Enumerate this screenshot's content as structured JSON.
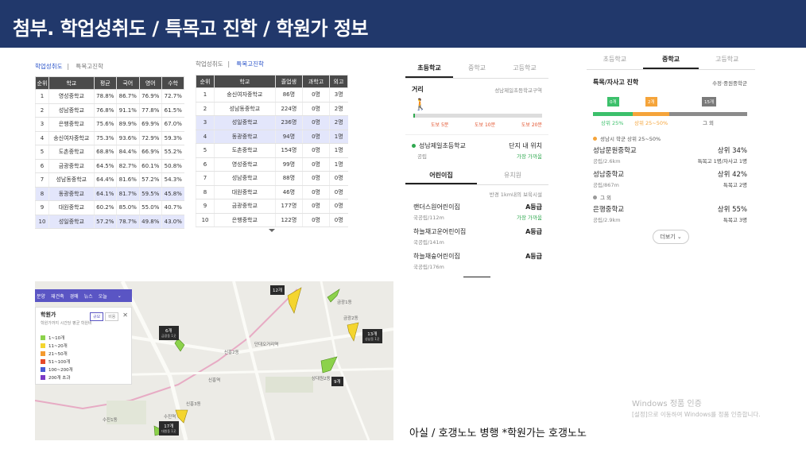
{
  "slide_title": "첨부. 학업성취도 / 특목고 진학 / 학원가 정보",
  "achievement": {
    "tabs": [
      "학업성취도",
      "특목고진학"
    ],
    "headers": [
      "순위",
      "학교",
      "평균",
      "국어",
      "영어",
      "수학"
    ],
    "rows": [
      [
        "1",
        "영성중학교",
        "78.8%",
        "86.7%",
        "76.9%",
        "72.7%"
      ],
      [
        "2",
        "성남중학교",
        "76.8%",
        "91.1%",
        "77.8%",
        "61.5%"
      ],
      [
        "3",
        "은행중학교",
        "75.6%",
        "89.9%",
        "69.9%",
        "67.0%"
      ],
      [
        "4",
        "송신여자중학교",
        "75.3%",
        "93.6%",
        "72.9%",
        "59.3%"
      ],
      [
        "5",
        "도촌중학교",
        "68.8%",
        "84.4%",
        "66.9%",
        "55.2%"
      ],
      [
        "6",
        "금광중학교",
        "64.5%",
        "82.7%",
        "60.1%",
        "50.8%"
      ],
      [
        "7",
        "성남동중학교",
        "64.4%",
        "81.6%",
        "57.2%",
        "54.3%"
      ],
      [
        "8",
        "동광중학교",
        "64.1%",
        "81.7%",
        "59.5%",
        "45.8%"
      ],
      [
        "9",
        "대원중학교",
        "60.2%",
        "85.0%",
        "55.0%",
        "40.7%"
      ],
      [
        "10",
        "성일중학교",
        "57.2%",
        "78.7%",
        "49.8%",
        "43.0%"
      ]
    ]
  },
  "special_hs": {
    "tabs": [
      "학업성취도",
      "특목고진학"
    ],
    "headers": [
      "순위",
      "학교",
      "졸업생",
      "과학고",
      "외고"
    ],
    "rows": [
      [
        "1",
        "숭신여자중학교",
        "86명",
        "0명",
        "3명"
      ],
      [
        "2",
        "성남동중학교",
        "224명",
        "0명",
        "2명"
      ],
      [
        "3",
        "성일중학교",
        "236명",
        "0명",
        "2명"
      ],
      [
        "4",
        "동광중학교",
        "94명",
        "0명",
        "1명"
      ],
      [
        "5",
        "도촌중학교",
        "154명",
        "0명",
        "1명"
      ],
      [
        "6",
        "영성중학교",
        "99명",
        "0명",
        "1명"
      ],
      [
        "7",
        "성남중학교",
        "88명",
        "0명",
        "0명"
      ],
      [
        "8",
        "대원중학교",
        "46명",
        "0명",
        "0명"
      ],
      [
        "9",
        "금광중학교",
        "177명",
        "0명",
        "0명"
      ],
      [
        "10",
        "은행중학교",
        "122명",
        "0명",
        "0명"
      ]
    ]
  },
  "elementary": {
    "tabs": [
      "초등학교",
      "중학교",
      "고등학교"
    ],
    "distance_label": "거리",
    "school_name_right": "성남제일초등학교구역",
    "walk_labels": [
      "도보 5분",
      "도보 10분",
      "도보 20분"
    ],
    "school": "성남제일초등학교",
    "school_type": "공립",
    "school_note": "단지 내 위치",
    "school_note2": "가장 가까움",
    "sub_tabs": [
      "어린이집",
      "유치원"
    ],
    "radius_note": "반경 1km내의 보육시설",
    "daycares": [
      {
        "name": "랜더스원어린이집",
        "meta": "국공립/112m",
        "grade": "A등급",
        "note": "가장 가까움"
      },
      {
        "name": "하늘채고운어린이집",
        "meta": "국공립/141m",
        "grade": "A등급",
        "note": ""
      },
      {
        "name": "하늘채숲어린이집",
        "meta": "국공립/176m",
        "grade": "A등급",
        "note": ""
      }
    ]
  },
  "middle": {
    "tabs": [
      "초등학교",
      "중학교",
      "고등학교"
    ],
    "heading": "특목/자사고 진학",
    "heading_right": "수정·중원중학군",
    "bar_values": [
      "0개",
      "2개",
      "15개"
    ],
    "bar_labels": [
      "상위 25%",
      "상위 25~50%",
      "그 외"
    ],
    "group1_label": "성남시 학군 상위 25~50%",
    "group2_label": "그 외",
    "schools": [
      {
        "name": "성남문원중학교",
        "meta": "공립/2.6km",
        "rank": "상위 34%",
        "detail": "특목고 1명/자사고 1명"
      },
      {
        "name": "성남중학교",
        "meta": "공립/867m",
        "rank": "상위 42%",
        "detail": "특목고 2명"
      },
      {
        "name": "은행중학교",
        "meta": "공립/2.9km",
        "rank": "상위 55%",
        "detail": "특목고 3명"
      }
    ],
    "more_button": "더보기"
  },
  "map": {
    "menu": [
      "분양",
      "재건축",
      "경매",
      "뉴스",
      "오늘"
    ],
    "panel_title": "학원가",
    "panel_sub": "학원가까지 시간당 평균 학원비",
    "toggle": [
      "규모",
      "비용"
    ],
    "legend": [
      {
        "label": "1~10개",
        "color": "#8cd24b"
      },
      {
        "label": "11~20개",
        "color": "#f4d52f"
      },
      {
        "label": "21~50개",
        "color": "#f49a2f"
      },
      {
        "label": "51~100개",
        "color": "#e64a2a"
      },
      {
        "label": "100~200개",
        "color": "#4a5ad6"
      },
      {
        "label": "200개 초과",
        "color": "#7a3bc6"
      }
    ],
    "tags": [
      "12개",
      "6개",
      "13개",
      "9개",
      "17개"
    ],
    "tag_subs": [
      "대원동 1곳",
      "금광동 1곳",
      "성남동 1곳"
    ],
    "places": [
      "신흥역",
      "수진1동",
      "신흥3동",
      "상대원2동",
      "금광1동",
      "수진역",
      "신흥2동",
      "단대오거리역",
      "금광2동"
    ]
  },
  "caption": "아실 / 호갱노노 병행  *학원가는 호갱노노",
  "watermark": {
    "line1": "Windows 정품 인증",
    "line2": "[설정]으로 이동하여 Windows를 정품 인증합니다."
  }
}
